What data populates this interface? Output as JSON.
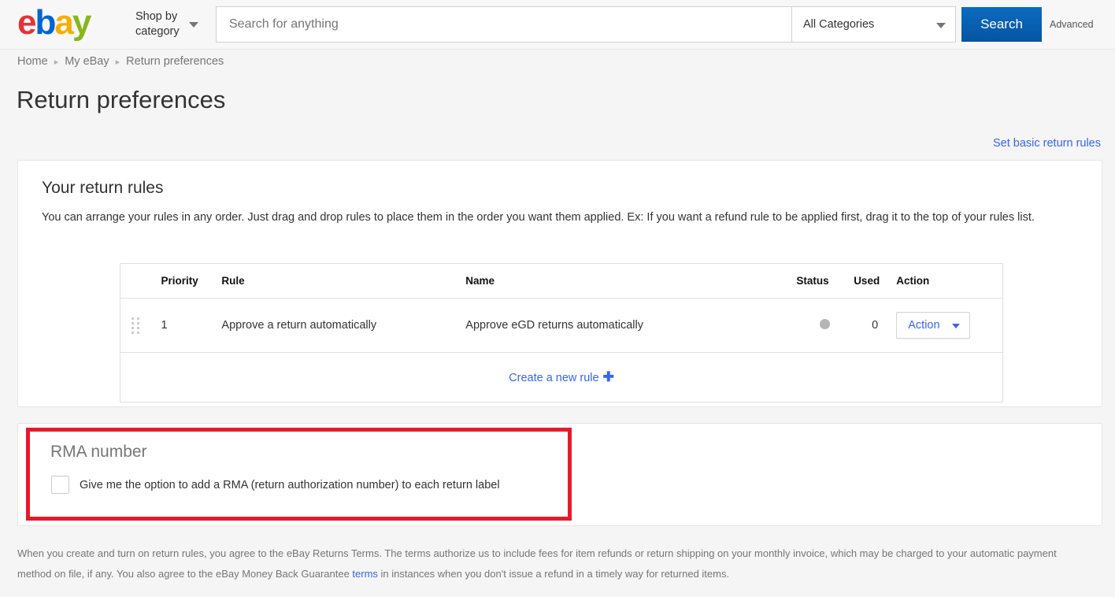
{
  "header": {
    "logo_text": "ebay",
    "logo_letters": [
      "e",
      "b",
      "a",
      "y"
    ],
    "shop_by_category": "Shop by category",
    "search_placeholder": "Search for anything",
    "search_value": "",
    "category_selected": "All Categories",
    "search_button": "Search",
    "advanced_link": "Advanced",
    "colors": {
      "logo_e": "#e53238",
      "logo_b": "#0064d2",
      "logo_a": "#f5af02",
      "logo_y": "#86b817",
      "search_button": "#0654a0",
      "link_blue": "#3665f3"
    }
  },
  "breadcrumb": {
    "items": [
      "Home",
      "My eBay",
      "Return preferences"
    ],
    "separator": "▸"
  },
  "page": {
    "title": "Return preferences",
    "basic_rules_link": "Set basic return rules"
  },
  "rules_card": {
    "title": "Your return rules",
    "description": "You can arrange your rules in any order. Just drag and drop rules to place them in the order you want them applied. Ex: If you want a refund rule to be applied first, drag it to the top of your rules list.",
    "table": {
      "headers": [
        "",
        "Priority",
        "Rule",
        "Name",
        "Status",
        "Used",
        "Action"
      ],
      "rows": [
        {
          "priority": "1",
          "rule": "Approve a return automatically",
          "name": "Approve eGD returns automatically",
          "status": "inactive",
          "used": "0",
          "action_label": "Action"
        }
      ],
      "create_link": "Create a new rule",
      "create_icon": "plus-icon"
    }
  },
  "rma_card": {
    "title": "RMA number",
    "checkbox_checked": false,
    "checkbox_label": "Give me the option to add a RMA (return authorization number) to each return label",
    "highlight_color": "#e8192c"
  },
  "footer": {
    "text_before_link": "When you create and turn on return rules, you agree to the eBay Returns Terms. The terms authorize us to include fees for item refunds or return shipping on your monthly invoice, which may be charged to your automatic payment method on file, if any. You also agree to the eBay Money Back Guarantee ",
    "link_text": "terms",
    "text_after_link": " in instances when you don't issue a refund in a timely way for returned items."
  }
}
